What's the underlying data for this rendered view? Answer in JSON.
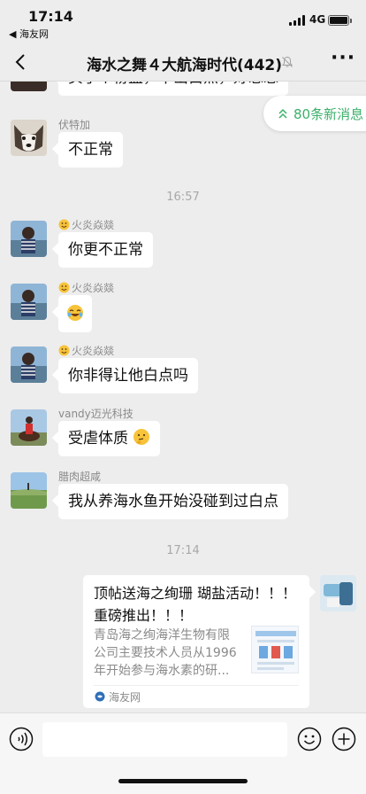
{
  "status_bar": {
    "time": "17:14",
    "back_app": "◀ 海友网",
    "network": "4G"
  },
  "nav": {
    "title": "海水之舞４大航海时代(442)",
    "more": "···"
  },
  "new_messages": {
    "label": "80条新消息"
  },
  "messages": [
    {
      "sender": "",
      "text": "买了个粉监，不出白点，好忘忘"
    },
    {
      "sender": "伏特加",
      "text": "不正常"
    },
    {
      "timestamp": "16:57"
    },
    {
      "sender": "火炎焱燚",
      "text": "你更不正常"
    },
    {
      "sender": "火炎焱燚",
      "text": "",
      "emoji": "laughing-tears-emoji"
    },
    {
      "sender": "火炎焱燚",
      "text": "你非得让他白点吗"
    },
    {
      "sender": "vandy迈光科技",
      "text": "受虐体质",
      "emoji": "thinking-emoji"
    },
    {
      "sender": "腊肉超咸",
      "text": "我从养海水鱼开始没碰到过白点"
    },
    {
      "timestamp": "17:14"
    }
  ],
  "link_card": {
    "title": "顶帖送海之绚珊 瑚盐活动！！！ 重磅推出！！！",
    "description": "青岛海之绚海洋生物有限公司主要技术人员从1996年开始参与海水素的研...",
    "source": "海友网"
  },
  "input": {
    "placeholder": ""
  },
  "colors": {
    "accent": "#3BB06A",
    "background": "#EDEDED",
    "bubble": "#FFFFFF"
  }
}
